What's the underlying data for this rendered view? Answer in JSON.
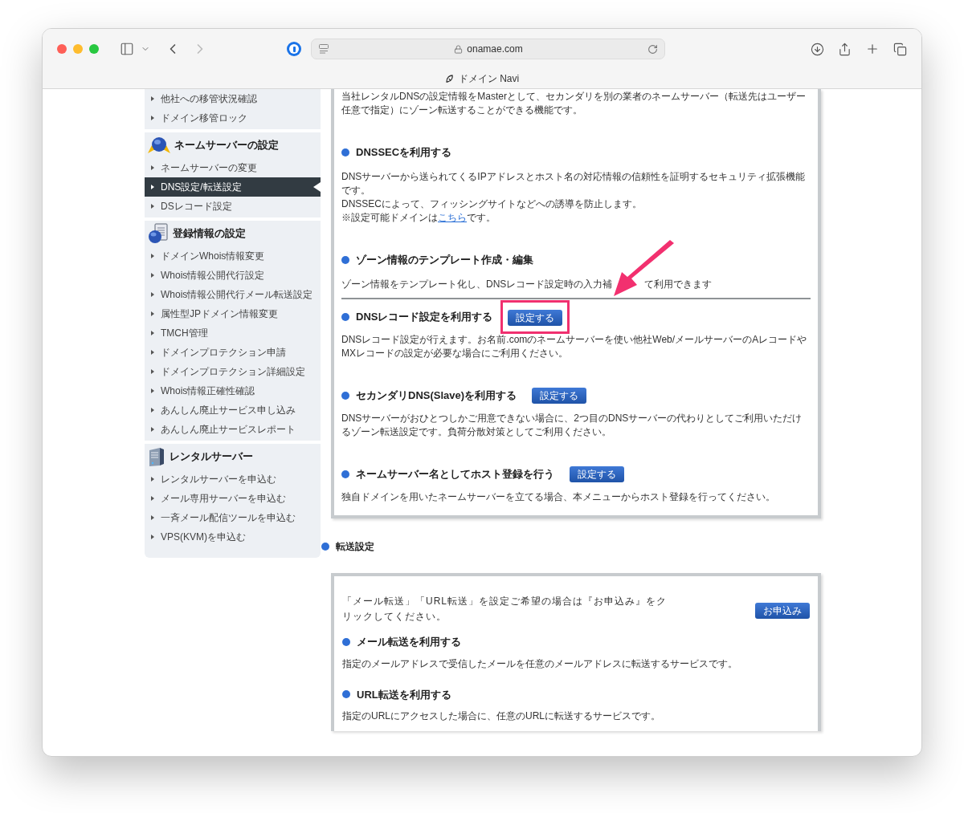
{
  "browser": {
    "address": "onamae.com",
    "tab_title": "ドメイン Navi"
  },
  "sidebar": {
    "groups": [
      {
        "kind": "plain",
        "items": [
          {
            "label": "他社への移管状況確認",
            "selected": false
          },
          {
            "label": "ドメイン移管ロック",
            "selected": false
          }
        ]
      },
      {
        "kind": "nameserver",
        "title": "ネームサーバーの設定",
        "items": [
          {
            "label": "ネームサーバーの変更",
            "selected": false
          },
          {
            "label": "DNS設定/転送設定",
            "selected": true
          },
          {
            "label": "DSレコード設定",
            "selected": false
          }
        ]
      },
      {
        "kind": "registration",
        "title": "登録情報の設定",
        "items": [
          {
            "label": "ドメインWhois情報変更",
            "selected": false
          },
          {
            "label": "Whois情報公開代行設定",
            "selected": false
          },
          {
            "label": "Whois情報公開代行メール転送設定",
            "selected": false
          },
          {
            "label": "属性型JPドメイン情報変更",
            "selected": false
          },
          {
            "label": "TMCH管理",
            "selected": false
          },
          {
            "label": "ドメインプロテクション申請",
            "selected": false
          },
          {
            "label": "ドメインプロテクション詳細設定",
            "selected": false
          },
          {
            "label": "Whois情報正確性確認",
            "selected": false
          },
          {
            "label": "あんしん廃止サービス申し込み",
            "selected": false
          },
          {
            "label": "あんしん廃止サービスレポート",
            "selected": false
          }
        ]
      },
      {
        "kind": "server",
        "title": "レンタルサーバー",
        "items": [
          {
            "label": "レンタルサーバーを申込む",
            "selected": false
          },
          {
            "label": "メール専用サーバーを申込む",
            "selected": false
          },
          {
            "label": "一斉メール配信ツールを申込む",
            "selected": false
          },
          {
            "label": "VPS(KVM)を申込む",
            "selected": false
          }
        ]
      }
    ]
  },
  "dns_box": {
    "intro": "当社レンタルDNSの設定情報をMasterとして、セカンダリを別の業者のネームサーバー（転送先はユーザー任意で指定）にゾーン転送することができる機能です。",
    "sections": [
      {
        "kind": "section",
        "title": "DNSSECを利用する",
        "description": "DNSサーバーから送られてくるIPアドレスとホスト名の対応情報の信頼性を証明するセキュリティ拡張機能です。\nDNSSECによって、フィッシングサイトなどへの誘導を防止します。",
        "note": {
          "before": "※設定可能ドメインは",
          "link": "こちら",
          "after": "です。"
        }
      },
      {
        "kind": "section",
        "title": "ゾーン情報のテンプレート作成・編集",
        "description": "ゾーン情報をテンプレート化し、DNSレコード設定時の入力補",
        "description_tail": "て利用できます"
      },
      {
        "kind": "divider"
      },
      {
        "kind": "section",
        "title": "DNSレコード設定を利用する",
        "button": "設定する",
        "highlighted": true,
        "description": "DNSレコード設定が行えます。お名前.comのネームサーバーを使い他社Web/メールサーバーのAレコードやMXレコードの設定が必要な場合にご利用ください。"
      },
      {
        "kind": "section",
        "title": "セカンダリDNS(Slave)を利用する",
        "button": "設定する",
        "highlighted": false,
        "description": "DNSサーバーがおひとつしかご用意できない場合に、2つ目のDNSサーバーの代わりとしてご利用いただけるゾーン転送設定です。負荷分散対策としてご利用ください。"
      },
      {
        "kind": "section",
        "title": "ネームサーバー名としてホスト登録を行う",
        "button": "設定する",
        "highlighted": false,
        "description": "独自ドメインを用いたネームサーバーを立てる場合、本メニューからホスト登録を行ってください。"
      }
    ]
  },
  "forwarding": {
    "heading": "転送設定",
    "intro": "「メール転送」「URL転送」を設定ご希望の場合は『お申込み』をクリックしてください。",
    "button": "お申込み",
    "sections": [
      {
        "title": "メール転送を利用する",
        "description": "指定のメールアドレスで受信したメールを任意のメールアドレスに転送するサービスです。"
      },
      {
        "title": "URL転送を利用する",
        "description": "指定のURLにアクセスした場合に、任意のURLに転送するサービスです。"
      }
    ]
  }
}
